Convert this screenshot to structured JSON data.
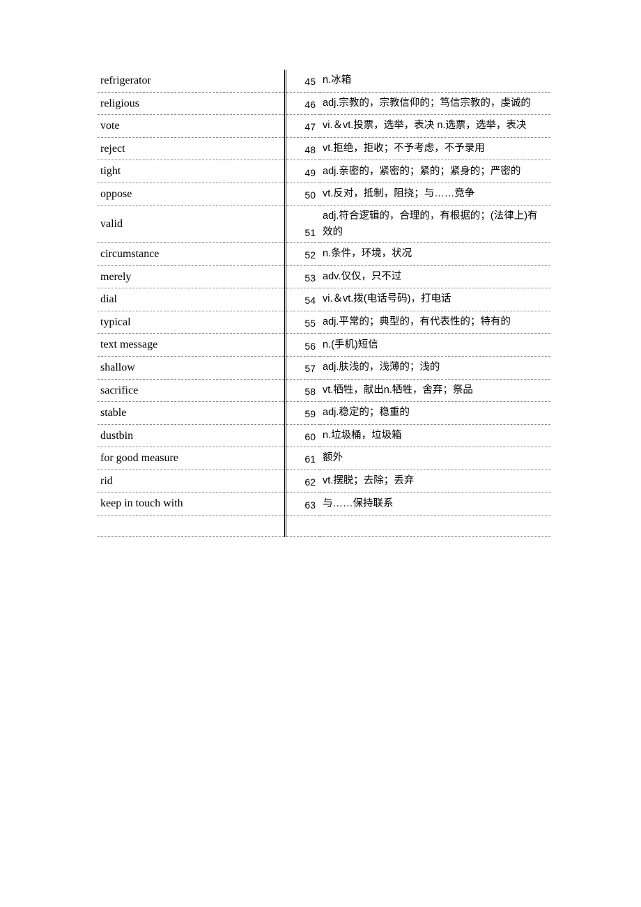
{
  "rows": [
    {
      "en": "refrigerator",
      "num": "45",
      "def": "n.冰箱"
    },
    {
      "en": "religious",
      "num": "46",
      "def": "adj.宗教的，宗教信仰的；笃信宗教的，虔诚的"
    },
    {
      "en": "vote",
      "num": "47",
      "def": "vi.＆vt.投票，选举，表决 n.选票，选举，表决"
    },
    {
      "en": "reject",
      "num": "48",
      "def": "vt.拒绝，拒收；不予考虑，不予录用"
    },
    {
      "en": "tight",
      "num": "49",
      "def": "adj.亲密的，紧密的；紧的；紧身的；严密的"
    },
    {
      "en": "oppose",
      "num": "50",
      "def": "vt.反对，抵制，阻挠；与……竞争"
    },
    {
      "en": "valid",
      "num": "51",
      "def": "adj.符合逻辑的，合理的，有根据的；(法律上)有效的"
    },
    {
      "en": "circumstance",
      "num": "52",
      "def": "n.条件，环境，状况"
    },
    {
      "en": "merely",
      "num": "53",
      "def": "adv.仅仅，只不过"
    },
    {
      "en": "dial",
      "num": "54",
      "def": "vi.＆vt.拨(电话号码)，打电话"
    },
    {
      "en": "typical",
      "num": "55",
      "def": "adj.平常的；典型的，有代表性的；特有的"
    },
    {
      "en": "text message",
      "num": "56",
      "def": "n.(手机)短信"
    },
    {
      "en": "shallow",
      "num": "57",
      "def": "adj.肤浅的，浅薄的；浅的"
    },
    {
      "en": "sacrifice",
      "num": "58",
      "def": "vt.牺牲，献出n.牺牲，舍弃；祭品"
    },
    {
      "en": "stable",
      "num": "59",
      "def": "adj.稳定的；稳重的"
    },
    {
      "en": "dustbin",
      "num": "60",
      "def": "n.垃圾桶，垃圾箱"
    },
    {
      "en": "for good measure",
      "num": "61",
      "def": "额外"
    },
    {
      "en": "rid",
      "num": "62",
      "def": "vt.摆脱；去除；丢弃"
    },
    {
      "en": "keep in touch with",
      "num": "63",
      "def": "与……保持联系"
    }
  ]
}
